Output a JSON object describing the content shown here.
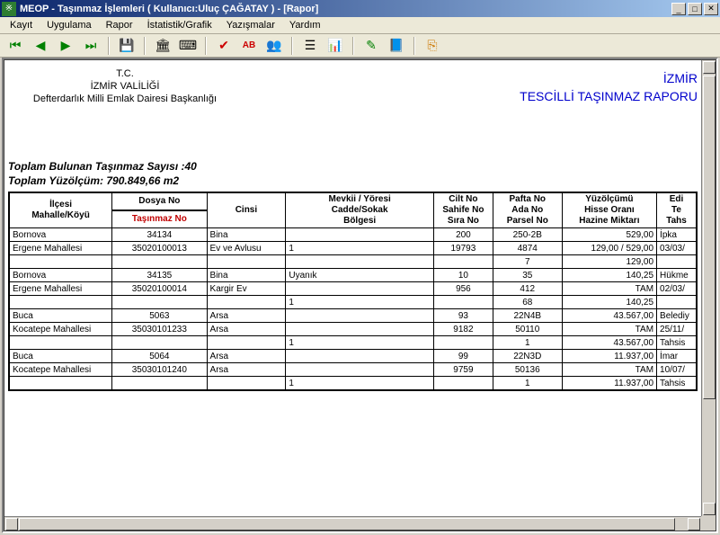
{
  "window": {
    "title": "MEOP - Taşınmaz İşlemleri ( Kullanıcı:Uluç ÇAĞATAY )  - [Rapor]"
  },
  "menu": {
    "items": [
      "Kayıt",
      "Uygulama",
      "Rapor",
      "İstatistik/Grafik",
      "Yazışmalar",
      "Yardım"
    ]
  },
  "toolbar_icons": [
    {
      "name": "nav-first-icon",
      "glyph": "⏮",
      "color": "#008000"
    },
    {
      "name": "nav-prev-icon",
      "glyph": "◀",
      "color": "#008000"
    },
    {
      "name": "nav-next-icon",
      "glyph": "▶",
      "color": "#008000"
    },
    {
      "name": "nav-last-icon",
      "glyph": "⏭",
      "color": "#008000"
    },
    {
      "name": "save-icon",
      "glyph": "💾",
      "color": ""
    },
    {
      "name": "bank-icon",
      "glyph": "🏛",
      "color": ""
    },
    {
      "name": "calc-icon",
      "glyph": "⌨",
      "color": ""
    },
    {
      "name": "check-icon",
      "glyph": "✔",
      "color": "#cc0000"
    },
    {
      "name": "font-icon",
      "glyph": "AB",
      "color": "#cc0000"
    },
    {
      "name": "people-icon",
      "glyph": "👥",
      "color": ""
    },
    {
      "name": "list-icon",
      "glyph": "☰",
      "color": ""
    },
    {
      "name": "chart-icon",
      "glyph": "📊",
      "color": ""
    },
    {
      "name": "brush-icon",
      "glyph": "✎",
      "color": "#008000"
    },
    {
      "name": "book-icon",
      "glyph": "📘",
      "color": ""
    },
    {
      "name": "exit-icon",
      "glyph": "⎘",
      "color": "#cc7700"
    }
  ],
  "header": {
    "tc": "T.C.",
    "valilik": "İZMİR VALİLİĞİ",
    "defterdarlik": "Defterdarlık Milli Emlak Dairesi Başkanlığı",
    "il": "İZMİR",
    "rapor_title": "TESCİLLİ TAŞINMAZ RAPORU"
  },
  "summary": {
    "count_label": "Toplam Bulunan Taşınmaz Sayısı :",
    "count_value": "40",
    "area_label": "Toplam Yüzölçüm: ",
    "area_value": "790.849,66 m2"
  },
  "columns": {
    "c1a": "İlçesi",
    "c1b": "Mahalle/Köyü",
    "c2a": "Dosya No",
    "c2b": "Taşınmaz No",
    "c3": "Cinsi",
    "c4a": "Mevkii / Yöresi",
    "c4b": "Cadde/Sokak",
    "c4c": "Bölgesi",
    "c5a": "Cilt No",
    "c5b": "Sahife No",
    "c5c": "Sıra No",
    "c6a": "Pafta No",
    "c6b": "Ada No",
    "c6c": "Parsel No",
    "c7a": "Yüzölçümü",
    "c7b": "Hisse Oranı",
    "c7c": "Hazine Miktarı",
    "c8a": "Edi",
    "c8b": "Te",
    "c8c": "Tahs"
  },
  "rows": [
    {
      "a": "Bornova",
      "b": "34134",
      "c": "Bina",
      "d": "",
      "e": "200",
      "f": "250-2B",
      "g": "529,00",
      "h": "İpka"
    },
    {
      "a": "Ergene Mahallesi",
      "b": "35020100013",
      "c": "Ev ve Avlusu",
      "d": "1",
      "e": "19793",
      "f": "4874",
      "g": "129,00 / 529,00",
      "h": "03/03/"
    },
    {
      "a": "",
      "b": "",
      "c": "",
      "d": "",
      "e": "",
      "f": "7",
      "g": "129,00",
      "h": ""
    },
    {
      "a": "Bornova",
      "b": "34135",
      "c": "Bina",
      "d": "Uyanık",
      "e": "10",
      "f": "35",
      "g": "140,25",
      "h": "Hükme"
    },
    {
      "a": "Ergene Mahallesi",
      "b": "35020100014",
      "c": "Kargir Ev",
      "d": "",
      "e": "956",
      "f": "412",
      "g": "TAM",
      "h": "02/03/"
    },
    {
      "a": "",
      "b": "",
      "c": "",
      "d": "1",
      "e": "",
      "f": "68",
      "g": "140,25",
      "h": ""
    },
    {
      "a": "Buca",
      "b": "5063",
      "c": "Arsa",
      "d": "",
      "e": "93",
      "f": "22N4B",
      "g": "43.567,00",
      "h": "Belediy"
    },
    {
      "a": "Kocatepe Mahallesi",
      "b": "35030101233",
      "c": "Arsa",
      "d": "",
      "e": "9182",
      "f": "50110",
      "g": "TAM",
      "h": "25/11/"
    },
    {
      "a": "",
      "b": "",
      "c": "",
      "d": "1",
      "e": "",
      "f": "1",
      "g": "43.567,00",
      "h": "Tahsis"
    },
    {
      "a": "Buca",
      "b": "5064",
      "c": "Arsa",
      "d": "",
      "e": "99",
      "f": "22N3D",
      "g": "11.937,00",
      "h": "İmar"
    },
    {
      "a": "Kocatepe Mahallesi",
      "b": "35030101240",
      "c": "Arsa",
      "d": "",
      "e": "9759",
      "f": "50136",
      "g": "TAM",
      "h": "10/07/"
    },
    {
      "a": "",
      "b": "",
      "c": "",
      "d": "1",
      "e": "",
      "f": "1",
      "g": "11.937,00",
      "h": "Tahsis"
    }
  ]
}
